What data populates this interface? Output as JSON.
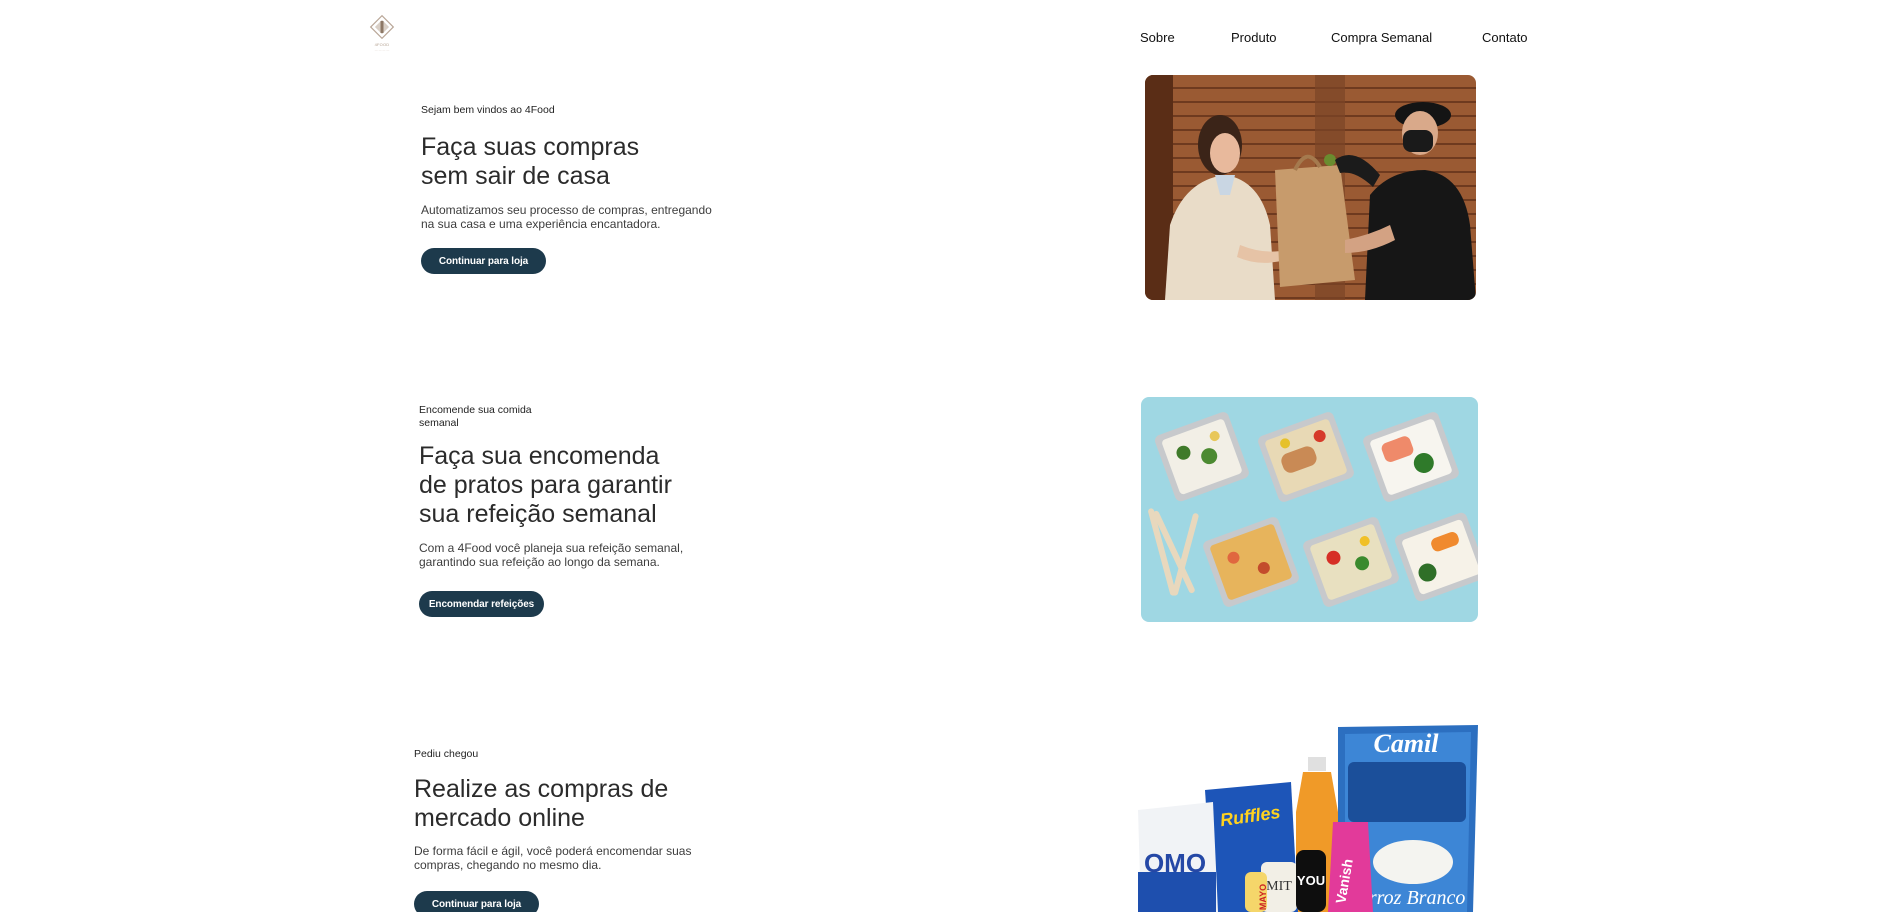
{
  "header": {
    "nav": [
      {
        "label": "Sobre"
      },
      {
        "label": "Produto"
      },
      {
        "label": "Compra Semanal"
      },
      {
        "label": "Contato"
      }
    ]
  },
  "hero": {
    "eyebrow": "Sejam bem vindos ao 4Food",
    "title_line1": "Faça suas compras",
    "title_line2": "sem sair de casa",
    "desc_line1": "Automatizamos seu processo de compras, entregando",
    "desc_line2": "na sua casa e uma experiência encantadora.",
    "button": "Continuar para loja"
  },
  "weekly": {
    "eyebrow_line1": "Encomende sua comida",
    "eyebrow_line2": "semanal",
    "title_line1": "Faça sua encomenda",
    "title_line2": "de pratos para garantir",
    "title_line3": "sua refeição semanal",
    "desc_line1": "Com a 4Food você planeja sua refeição semanal,",
    "desc_line2": "garantindo sua refeição ao longo da semana.",
    "button": "Encomendar refeições"
  },
  "market": {
    "eyebrow": "Pediu chegou",
    "title_line1": "Realize as compras de",
    "title_line2": "mercado online",
    "desc_line1": "De forma fácil e ágil, você poderá encomendar suas",
    "desc_line2": "compras, chegando no mesmo dia.",
    "button": "Continuar para loja"
  },
  "products": {
    "camil_brand": "Camil",
    "camil_sub": "Arroz Branco",
    "omo": "OMO",
    "ruffles": "Ruffles",
    "vanish": "Vanish",
    "mit": "MIT",
    "you": "YOU",
    "mayo": "MAYO"
  },
  "colors": {
    "button_bg": "#1d3a4c",
    "meal_bg": "#9fd7e3"
  }
}
